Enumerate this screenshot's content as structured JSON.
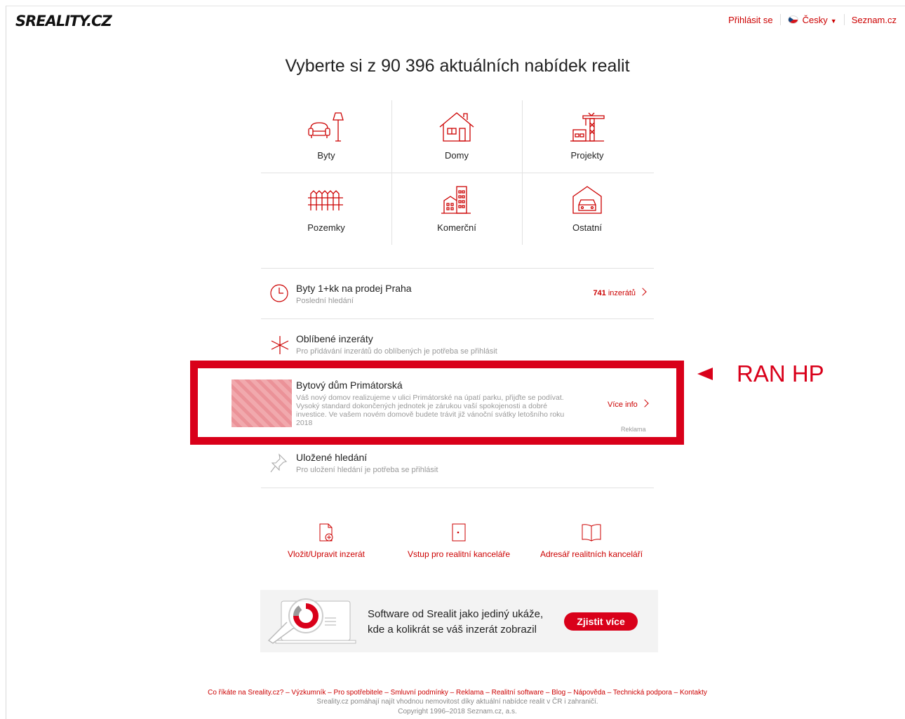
{
  "header": {
    "logo": "SREALITY.CZ",
    "login": "Přihlásit se",
    "language": "Česky",
    "portal": "Seznam.cz"
  },
  "title": "Vyberte si z  90 396  aktuálních nabídek realit",
  "categories": [
    {
      "label": "Byty",
      "icon": "armchair-lamp-icon"
    },
    {
      "label": "Domy",
      "icon": "house-icon"
    },
    {
      "label": "Projekty",
      "icon": "crane-icon"
    },
    {
      "label": "Pozemky",
      "icon": "fence-icon"
    },
    {
      "label": "Komerční",
      "icon": "commercial-building-icon"
    },
    {
      "label": "Ostatní",
      "icon": "garage-icon"
    }
  ],
  "recent": {
    "title": "Byty 1+kk na prodej Praha",
    "subtitle": "Poslední hledání",
    "count": "741",
    "count_suffix": "inzerátů"
  },
  "favorites": {
    "title": "Oblíbené inzeráty",
    "subtitle": "Pro přidávání inzerátů do oblíbených je potřeba se přihlásit"
  },
  "ad": {
    "title": "Bytový dům Primátorská",
    "description": "Váš nový domov realizujeme v ulici Primátorské na úpatí parku, přijďte se podívat. Vysoký standard dokončených jednotek je zárukou vaší spokojenosti a dobré investice. Ve vašem novém domově budete trávit již vánoční svátky letošního roku 2018",
    "more": "Více info",
    "tag": "Reklama"
  },
  "annotation": {
    "label": "RAN HP",
    "color": "#d9001a"
  },
  "saved": {
    "title": "Uložené hledání",
    "subtitle": "Pro uložení hledání je potřeba se přihlásit"
  },
  "quick_links": [
    {
      "label": "Vložit/Upravit inzerát",
      "icon": "document-add-icon"
    },
    {
      "label": "Vstup pro realitní kanceláře",
      "icon": "door-icon"
    },
    {
      "label": "Adresář realitních kanceláří",
      "icon": "book-icon"
    }
  ],
  "promo": {
    "line1": "Software od Srealit jako jediný ukáže,",
    "line2": "kde a kolikrát se váš inzerát zobrazil",
    "button": "Zjistit více"
  },
  "footer": {
    "links": [
      "Co říkáte na Sreality.cz?",
      "Výzkumník",
      "Pro spotřebitele",
      "Smluvní podmínky",
      "Reklama",
      "Realitní software",
      "Blog",
      "Nápověda",
      "Technická podpora",
      "Kontakty"
    ],
    "separator": " – ",
    "text": "Sreality.cz pomáhají najít vhodnou nemovitost díky aktuální nabídce realit v ČR i zahraničí.",
    "copyright": "Copyright 1996–2018 Seznam.cz, a.s."
  },
  "colors": {
    "accent": "#cc0000",
    "annotation": "#d9001a"
  }
}
